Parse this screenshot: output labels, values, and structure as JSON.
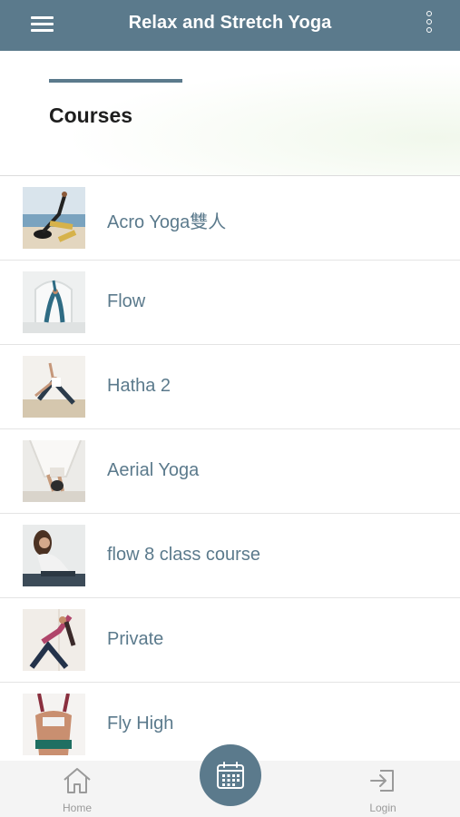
{
  "app": {
    "title": "Relax and Stretch Yoga"
  },
  "page": {
    "title": "Courses"
  },
  "courses": [
    {
      "label": "Acro Yoga雙人"
    },
    {
      "label": "Flow"
    },
    {
      "label": "Hatha 2"
    },
    {
      "label": "Aerial Yoga"
    },
    {
      "label": "flow 8 class course"
    },
    {
      "label": "Private"
    },
    {
      "label": "Fly High"
    }
  ],
  "bottom_nav": {
    "home_label": "Home",
    "login_label": "Login"
  },
  "colors": {
    "accent": "#5b7a8c",
    "nav_background": "#f4f4f4",
    "nav_text": "#9a9a9a"
  }
}
